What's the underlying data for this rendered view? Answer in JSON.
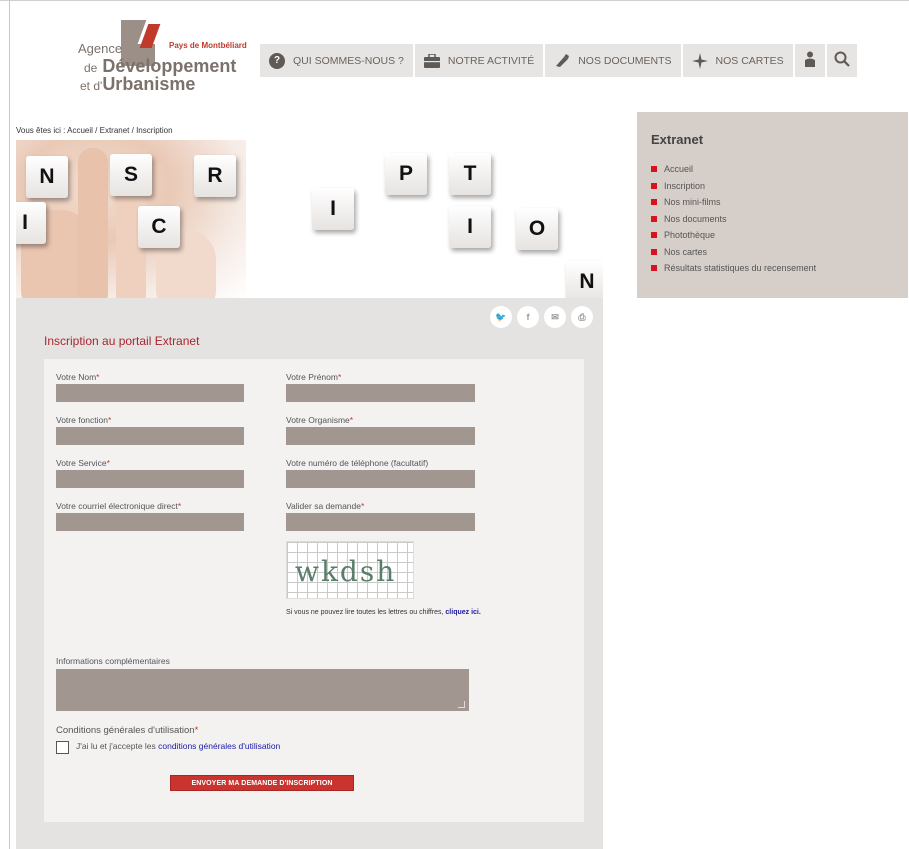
{
  "logo": {
    "agence": "Agence",
    "pays": "Pays de Montbéliard",
    "de": "de",
    "developpement": "Développement",
    "et": "et d'",
    "urbanisme": "Urbanisme"
  },
  "nav": {
    "items": [
      {
        "label": "QUI SOMMES-NOUS ?",
        "icon": "question-icon"
      },
      {
        "label": "NOTRE ACTIVITÉ",
        "icon": "briefcase-icon"
      },
      {
        "label": "NOS DOCUMENTS",
        "icon": "document-icon"
      },
      {
        "label": "NOS CARTES",
        "icon": "compass-icon"
      }
    ],
    "user_icon": "user-icon",
    "search_icon": "search-icon"
  },
  "breadcrumb": {
    "prefix": "Vous êtes ici : ",
    "items": [
      "Accueil",
      "Extranet",
      "Inscription"
    ],
    "separator": " / "
  },
  "hero": {
    "letters": [
      "N",
      "S",
      "R",
      "I",
      "C",
      "I",
      "P",
      "T",
      "I",
      "O",
      "N"
    ]
  },
  "sidebar": {
    "title": "Extranet",
    "items": [
      "Accueil",
      "Inscription",
      "Nos mini-films",
      "Nos documents",
      "Photothèque",
      "Nos cartes",
      "Résultats statistiques du recensement"
    ]
  },
  "social": [
    "twitter-icon",
    "facebook-icon",
    "mail-icon",
    "print-icon"
  ],
  "social_glyphs": [
    "🐦",
    "f",
    "✉",
    "⎙"
  ],
  "form": {
    "title": "Inscription au portail Extranet",
    "fields": {
      "nom": "Votre Nom",
      "prenom": "Votre Prénom",
      "fonction": "Votre fonction",
      "organisme": "Votre Organisme",
      "service": "Votre Service",
      "telephone": "Votre numéro de téléphone (facultatif)",
      "courriel": "Votre courriel électronique direct",
      "valider": "Valider sa demande"
    },
    "required_mark": "*",
    "captcha_text": "wkdsh",
    "captcha_note": "Si vous ne pouvez lire toutes les lettres ou chiffres, ",
    "captcha_link": "cliquez ici.",
    "info_label": "Informations complémentaires",
    "cgu_label": "Conditions générales d'utilisation",
    "cgu_text": "J'ai lu et j'accepte les ",
    "cgu_link": "conditions générales d'utilisation",
    "submit": "ENVOYER MA DEMANDE D'INSCRIPTION"
  },
  "colors": {
    "accent_red": "#d6131e",
    "field_fill": "#a29690",
    "sidebar_bg": "#d6cec9",
    "content_bg": "#e5e3e2"
  }
}
